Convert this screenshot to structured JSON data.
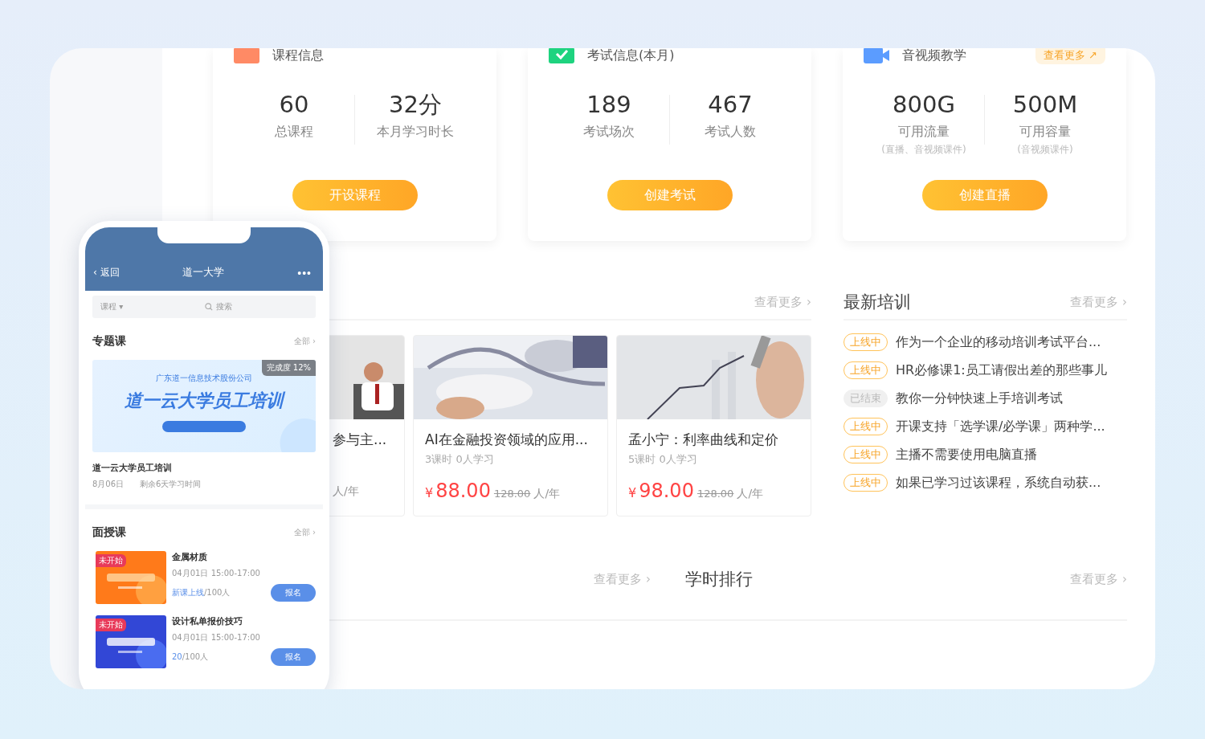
{
  "stat_cards": [
    {
      "kind": "course",
      "title": "课程信息",
      "stats": [
        {
          "value": "60",
          "label": "总课程"
        },
        {
          "value": "32分",
          "label": "本月学习时长"
        }
      ],
      "button": "开设课程"
    },
    {
      "kind": "exam",
      "title": "考试信息(本月)",
      "stats": [
        {
          "value": "189",
          "label": "考试场次"
        },
        {
          "value": "467",
          "label": "考试人数"
        }
      ],
      "button": "创建考试"
    },
    {
      "kind": "video",
      "title": "音视频教学",
      "more": "查看更多 ↗",
      "stats": [
        {
          "value": "800G",
          "label": "可用流量",
          "note": "(直播、音视频课件)"
        },
        {
          "value": "500M",
          "label": "可用容量",
          "note": "(音视频课件)"
        }
      ],
      "button": "创建直播"
    }
  ],
  "courses": {
    "more": "查看更多 ›",
    "cards": [
      {
        "title": "参与主...",
        "price_unit": "人/年"
      },
      {
        "title": "AI在金融投资领域的应用...",
        "meta": "3课时  0人学习",
        "currency": "¥",
        "price": "88.00",
        "old_price": "128.00",
        "price_unit": "人/年"
      },
      {
        "title": "孟小宁：利率曲线和定价",
        "meta": "5课时  0人学习",
        "currency": "¥",
        "price": "98.00",
        "old_price": "128.00",
        "price_unit": "人/年"
      }
    ]
  },
  "trainings": {
    "title": "最新培训",
    "more": "查看更多 ›",
    "items": [
      {
        "status": "上线中",
        "active": true,
        "text": "作为一个企业的移动培训考试平台..."
      },
      {
        "status": "上线中",
        "active": true,
        "text": "HR必修课1:员工请假出差的那些事儿"
      },
      {
        "status": "已结束",
        "active": false,
        "text": "教你一分钟快速上手培训考试"
      },
      {
        "status": "上线中",
        "active": true,
        "text": "开课支持「选学课/必学课」两种学..."
      },
      {
        "status": "上线中",
        "active": true,
        "text": "主播不需要使用电脑直播"
      },
      {
        "status": "上线中",
        "active": true,
        "text": "如果已学习过该课程，系统自动获..."
      }
    ]
  },
  "bottom": {
    "left_more": "查看更多 ›",
    "ranking_title": "学时排行",
    "ranking_more": "查看更多 ›"
  },
  "phone": {
    "back": "‹ 返回",
    "title": "道一大学",
    "menu": "•••",
    "filter": "课程 ▾",
    "search_placeholder": "搜索",
    "topic": {
      "title": "专题课",
      "all": "全部 ›",
      "banner_company": "广东道一信息技术股份公司",
      "banner_title": "道一云大学员工培训",
      "progress": "完成度 12%",
      "name": "道一云大学员工培训",
      "date": "8月06日",
      "remaining": "剩余6天学习时间"
    },
    "offline": {
      "title": "面授课",
      "all": "全部 ›",
      "items": [
        {
          "tag": "未开始",
          "title": "金属材质",
          "time": "04月01日 15:00-17:00",
          "count_highlight": "新课上线",
          "count_rest": "/100人",
          "button": "报名"
        },
        {
          "tag": "未开始",
          "title": "设计私单报价技巧",
          "time": "04月01日 15:00-17:00",
          "count_highlight": "20",
          "count_rest": "/100人",
          "button": "报名"
        }
      ]
    }
  }
}
